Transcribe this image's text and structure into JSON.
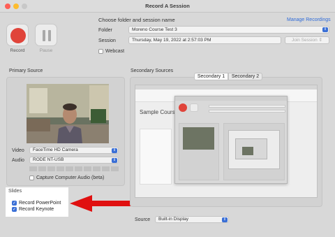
{
  "window": {
    "title": "Record A Session"
  },
  "controls": {
    "record_label": "Record",
    "pause_label": "Pause"
  },
  "form": {
    "heading": "Choose folder and session name",
    "manage_link": "Manage Recordings",
    "folder_label": "Folder",
    "folder_value": "Moreno Course Test 3",
    "session_label": "Session",
    "session_value": "Thursday, May 19, 2022 at 2:57:03 PM",
    "join_label": "Join Session",
    "webcast_label": "Webcast"
  },
  "primary": {
    "title": "Primary Source",
    "video_label": "Video",
    "video_value": "FaceTime HD Camera",
    "audio_label": "Audio",
    "audio_value": "RODE NT-USB",
    "computer_audio_label": "Capture Computer Audio (beta)"
  },
  "slides": {
    "title": "Slides",
    "items": [
      {
        "label": "Record PowerPoint",
        "checked": true
      },
      {
        "label": "Record Keynote",
        "checked": true
      }
    ]
  },
  "secondary": {
    "title": "Secondary Sources",
    "tabs": [
      "Secondary 1",
      "Secondary 2"
    ],
    "preview_title": "Sample Course",
    "source_label": "Source",
    "source_value": "Built-in Display"
  },
  "colors": {
    "accent": "#3a6fd6",
    "record": "#e0443a",
    "arrow": "#e01010"
  },
  "icons": {
    "record": "record-icon",
    "pause": "pause-icon",
    "chevron": "chevron-updown-icon",
    "arrow": "red-arrow-icon"
  }
}
